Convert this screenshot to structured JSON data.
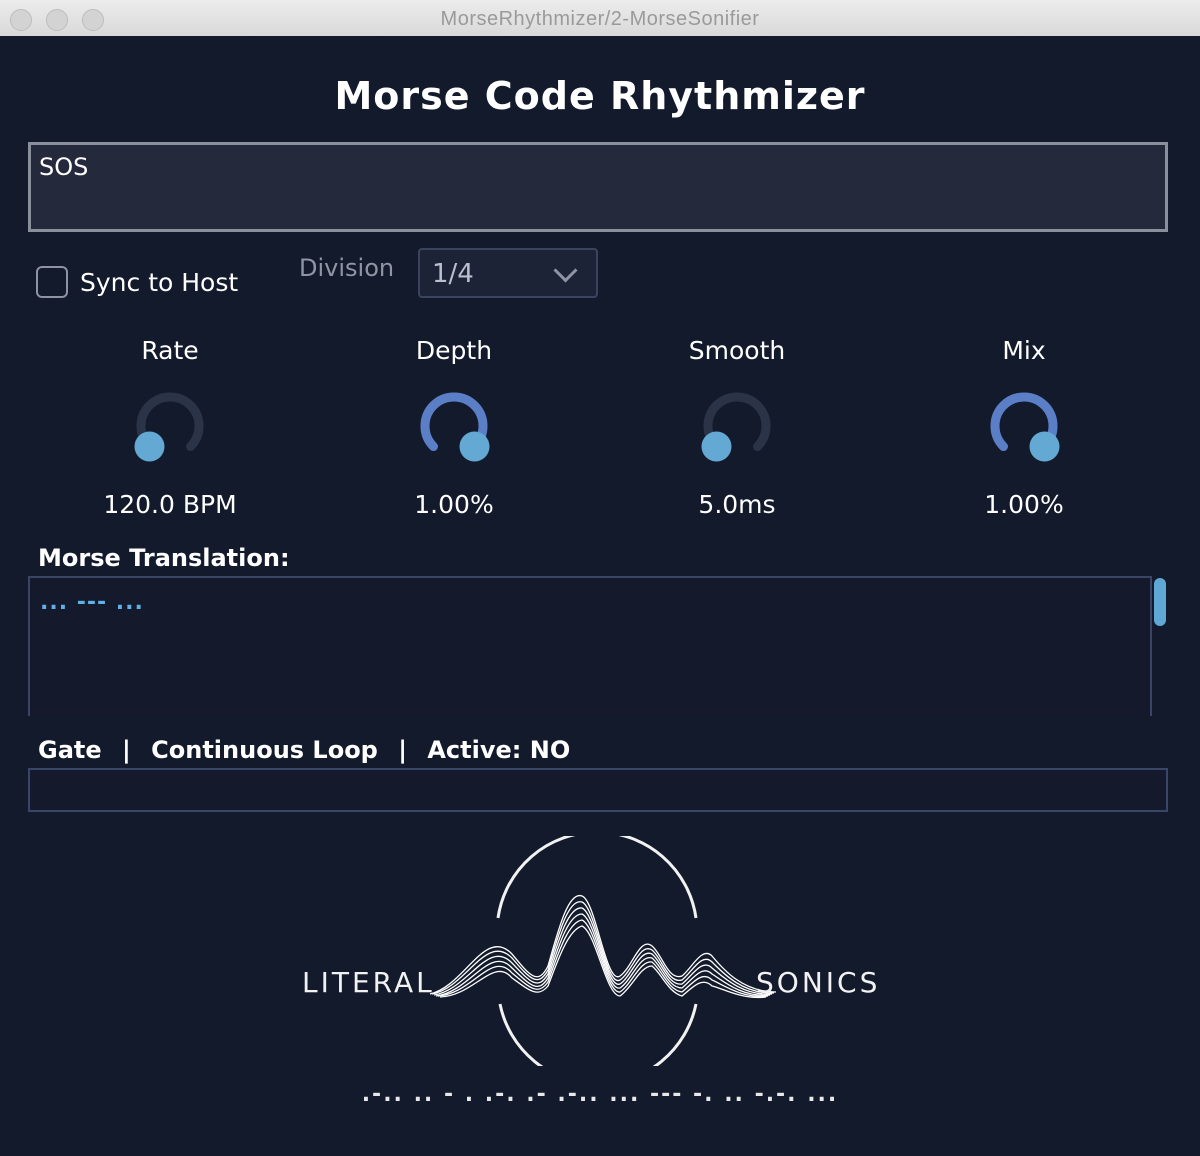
{
  "window": {
    "title": "MorseRhythmizer/2-MorseSonifier"
  },
  "header": {
    "title": "Morse Code Rhythmizer"
  },
  "input": {
    "value": "SOS"
  },
  "controls": {
    "sync_label": "Sync to Host",
    "sync_checked": false,
    "division_label": "Division",
    "division_value": "1/4"
  },
  "knobs": [
    {
      "label": "Rate",
      "value_text": "120.0 BPM",
      "level": 0.0
    },
    {
      "label": "Depth",
      "value_text": "1.00%",
      "level": 1.0
    },
    {
      "label": "Smooth",
      "value_text": "5.0ms",
      "level": 0.0
    },
    {
      "label": "Mix",
      "value_text": "1.00%",
      "level": 1.0
    }
  ],
  "translation": {
    "heading": "Morse Translation:",
    "text": "... --- ..."
  },
  "status": {
    "mode": "Gate",
    "sep1": "|",
    "loop": "Continuous Loop",
    "sep2": "|",
    "active": "Active: NO"
  },
  "logo": {
    "left_word": "LITERAL",
    "right_word": "SONICS",
    "morse": ".-.. .. - . .-. .- .-..   ... --- -. .. -.-. ..."
  },
  "colors": {
    "background": "#131a2c",
    "accent": "#5b7fc6",
    "knob_dot": "#63a9d4",
    "track": "#2b3347",
    "morse_text": "#5fb0e6"
  }
}
